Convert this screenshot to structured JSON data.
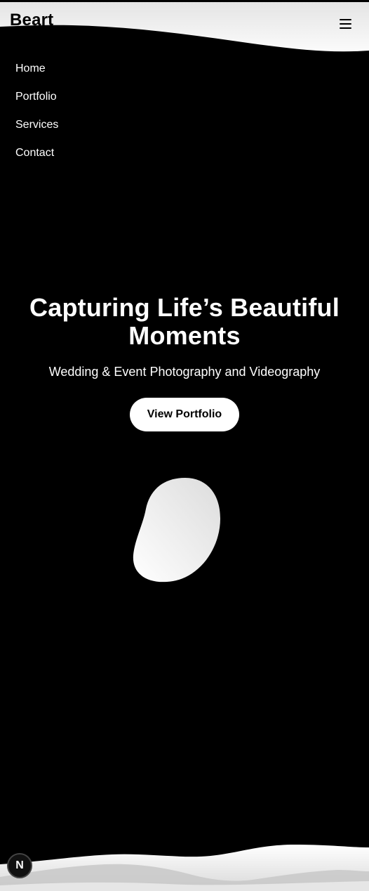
{
  "header": {
    "brand": "Beart",
    "menu_icon": "hamburger-menu-icon"
  },
  "nav": {
    "items": [
      {
        "label": "Home"
      },
      {
        "label": "Portfolio"
      },
      {
        "label": "Services"
      },
      {
        "label": "Contact"
      }
    ]
  },
  "hero": {
    "title": "Capturing Life’s Beautiful Moments",
    "subtitle": "Wedding & Event Photography and Videography",
    "cta_label": "View Portfolio"
  },
  "badge": {
    "label": "N",
    "icon": "nextjs-logo-icon"
  },
  "colors": {
    "background": "#000000",
    "text": "#ffffff",
    "wave_light": "#f2f2f2",
    "wave_mid": "#d0d0d0",
    "button_bg": "#ffffff",
    "button_text": "#000000"
  }
}
